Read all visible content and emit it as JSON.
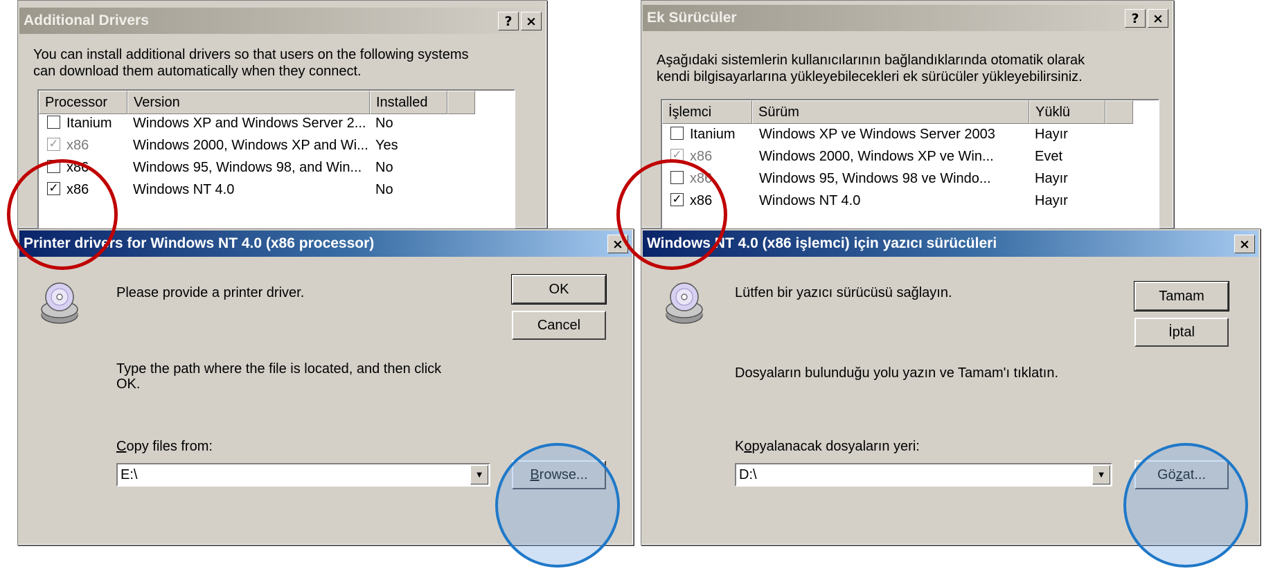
{
  "colors": {
    "title_active": "#0a246a",
    "title_inactive": "#9c988c",
    "face": "#d4d0c8",
    "red_circle": "#c00000",
    "blue_circle": "#1f78c8"
  },
  "left": {
    "bg_dialog": {
      "title": "Additional Drivers",
      "help": "?",
      "close": "×",
      "intro_line1": "You can install additional drivers so that users on the following systems",
      "intro_line2": "can download them automatically when they connect.",
      "headers": [
        "Processor",
        "Version",
        "Installed"
      ],
      "rows": [
        {
          "processor": "Itanium",
          "version": "Windows XP and Windows Server 2...",
          "installed": "No",
          "state": "unchecked"
        },
        {
          "processor": "x86",
          "version": "Windows 2000, Windows XP and Wi...",
          "installed": "Yes",
          "state": "grey"
        },
        {
          "processor": "x86",
          "version": "Windows 95, Windows 98, and Win...",
          "installed": "No",
          "state": "unchecked"
        },
        {
          "processor": "x86",
          "version": "Windows NT 4.0",
          "installed": "No",
          "state": "checked"
        }
      ]
    },
    "fg_dialog": {
      "title": "Printer drivers for Windows NT 4.0 (x86 processor)",
      "close": "×",
      "message": "Please provide a printer driver.",
      "ok": "OK",
      "cancel": "Cancel",
      "instruction_line1": "Type the path where the file is located, and then click",
      "instruction_line2": "OK.",
      "copy_label_mnemonic": "C",
      "copy_label_rest": "opy files from:",
      "path": "E:\\",
      "browse_mnemonic": "B",
      "browse_rest": "rowse..."
    }
  },
  "right": {
    "bg_dialog": {
      "title": "Ek Sürücüler",
      "help": "?",
      "close": "×",
      "intro_line1": "Aşağıdaki sistemlerin kullanıcılarının bağlandıklarında otomatik olarak",
      "intro_line2": "kendi bilgisayarlarına yükleyebilecekleri ek sürücüler yükleyebilirsiniz.",
      "headers": [
        "İşlemci",
        "Sürüm",
        "Yüklü"
      ],
      "rows": [
        {
          "processor": "Itanium",
          "version": "Windows XP ve Windows Server 2003",
          "installed": "Hayır",
          "state": "unchecked"
        },
        {
          "processor": "x86",
          "version": "Windows 2000, Windows XP ve Win...",
          "installed": "Evet",
          "state": "grey"
        },
        {
          "processor": "x86",
          "version": "Windows 95, Windows 98 ve Windo...",
          "installed": "Hayır",
          "state": "unchecked"
        },
        {
          "processor": "x86",
          "version": "Windows NT 4.0",
          "installed": "Hayır",
          "state": "checked"
        }
      ]
    },
    "fg_dialog": {
      "title": "Windows NT 4.0 (x86 işlemci) için yazıcı sürücüleri",
      "close": "×",
      "message": "Lütfen bir yazıcı sürücüsü sağlayın.",
      "ok": "Tamam",
      "cancel": "İptal",
      "instruction_line1": "Dosyaların bulunduğu yolu yazın ve Tamam'ı tıklatın.",
      "copy_label_pre": "K",
      "copy_label_mnemonic": "o",
      "copy_label_rest": "pyalanacak dosyaların yeri:",
      "path": "D:\\",
      "browse_pre": "Gö",
      "browse_mnemonic": "z",
      "browse_rest": "at..."
    }
  }
}
